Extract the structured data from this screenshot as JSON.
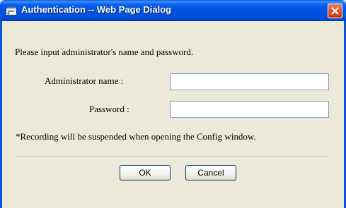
{
  "window": {
    "title": "Authentication -- Web Page Dialog",
    "title_icon": "web-page-dialog-icon",
    "close_icon": "close-icon"
  },
  "form": {
    "intro_text": "Please input administrator's name and password.",
    "admin_name_label": "Administrator name :",
    "admin_name_value": "",
    "password_label": "Password :",
    "password_value": "",
    "note_text": "*Recording will be suspended when opening the Config window."
  },
  "buttons": {
    "ok_label": "OK",
    "cancel_label": "Cancel"
  },
  "colors": {
    "titlebar": "#0054e3",
    "client_background": "#ece9d8",
    "close_button": "#e0542c",
    "input_border": "#7f9db9"
  }
}
